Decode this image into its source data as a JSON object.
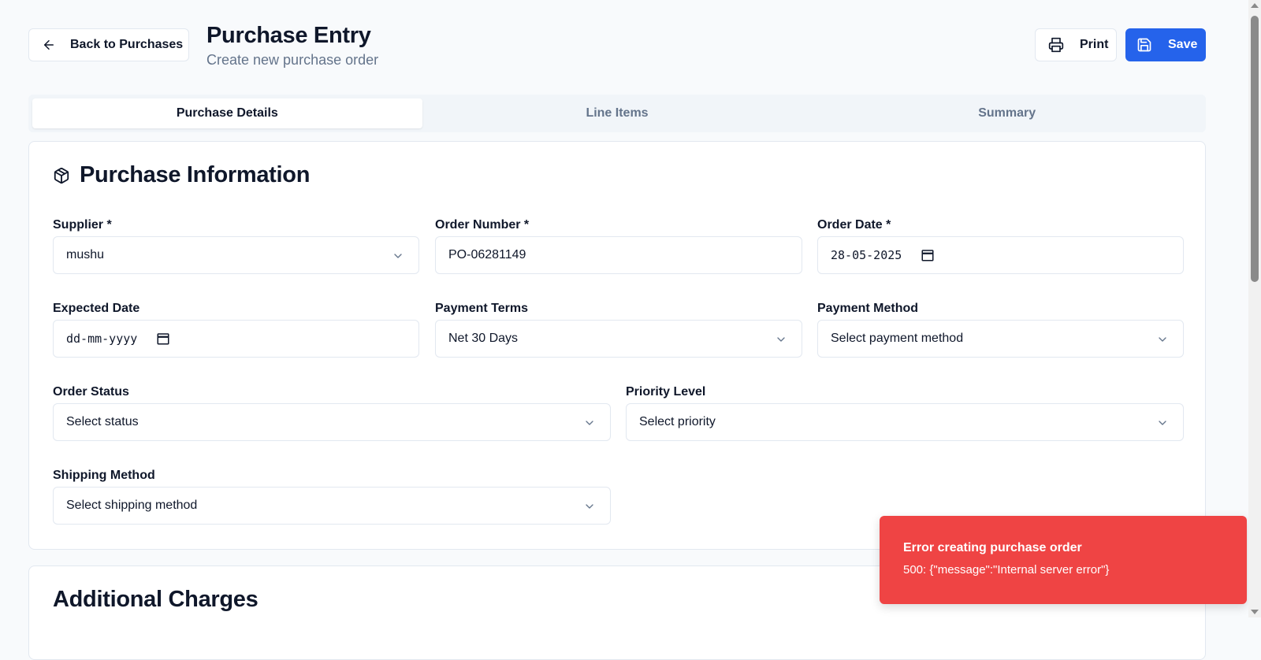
{
  "header": {
    "back_label": "Back to Purchases",
    "title": "Purchase Entry",
    "subtitle": "Create new purchase order",
    "print_label": "Print",
    "save_label": "Save"
  },
  "tabs": [
    {
      "label": "Purchase Details",
      "active": true
    },
    {
      "label": "Line Items",
      "active": false
    },
    {
      "label": "Summary",
      "active": false
    }
  ],
  "purchase_info": {
    "title": "Purchase Information",
    "icon": "package-icon",
    "fields": {
      "supplier": {
        "label": "Supplier *",
        "value": "mushu"
      },
      "order_number": {
        "label": "Order Number *",
        "value": "PO-06281149"
      },
      "order_date": {
        "label": "Order Date *",
        "value": "28-05-2025"
      },
      "expected_date": {
        "label": "Expected Date",
        "value": "dd-mm-yyyy"
      },
      "payment_terms": {
        "label": "Payment Terms",
        "value": "Net 30 Days"
      },
      "payment_method": {
        "label": "Payment Method",
        "value": "Select payment method"
      },
      "order_status": {
        "label": "Order Status",
        "value": "Select status"
      },
      "priority_level": {
        "label": "Priority Level",
        "value": "Select priority"
      },
      "shipping_method": {
        "label": "Shipping Method",
        "value": "Select shipping method"
      }
    }
  },
  "additional_charges": {
    "title": "Additional Charges"
  },
  "toast": {
    "title": "Error creating purchase order",
    "message": "500: {\"message\":\"Internal server error\"}",
    "color": "#ef4444"
  },
  "colors": {
    "accent": "#2563eb",
    "background": "#f8fafc",
    "muted_text": "#64748b"
  }
}
